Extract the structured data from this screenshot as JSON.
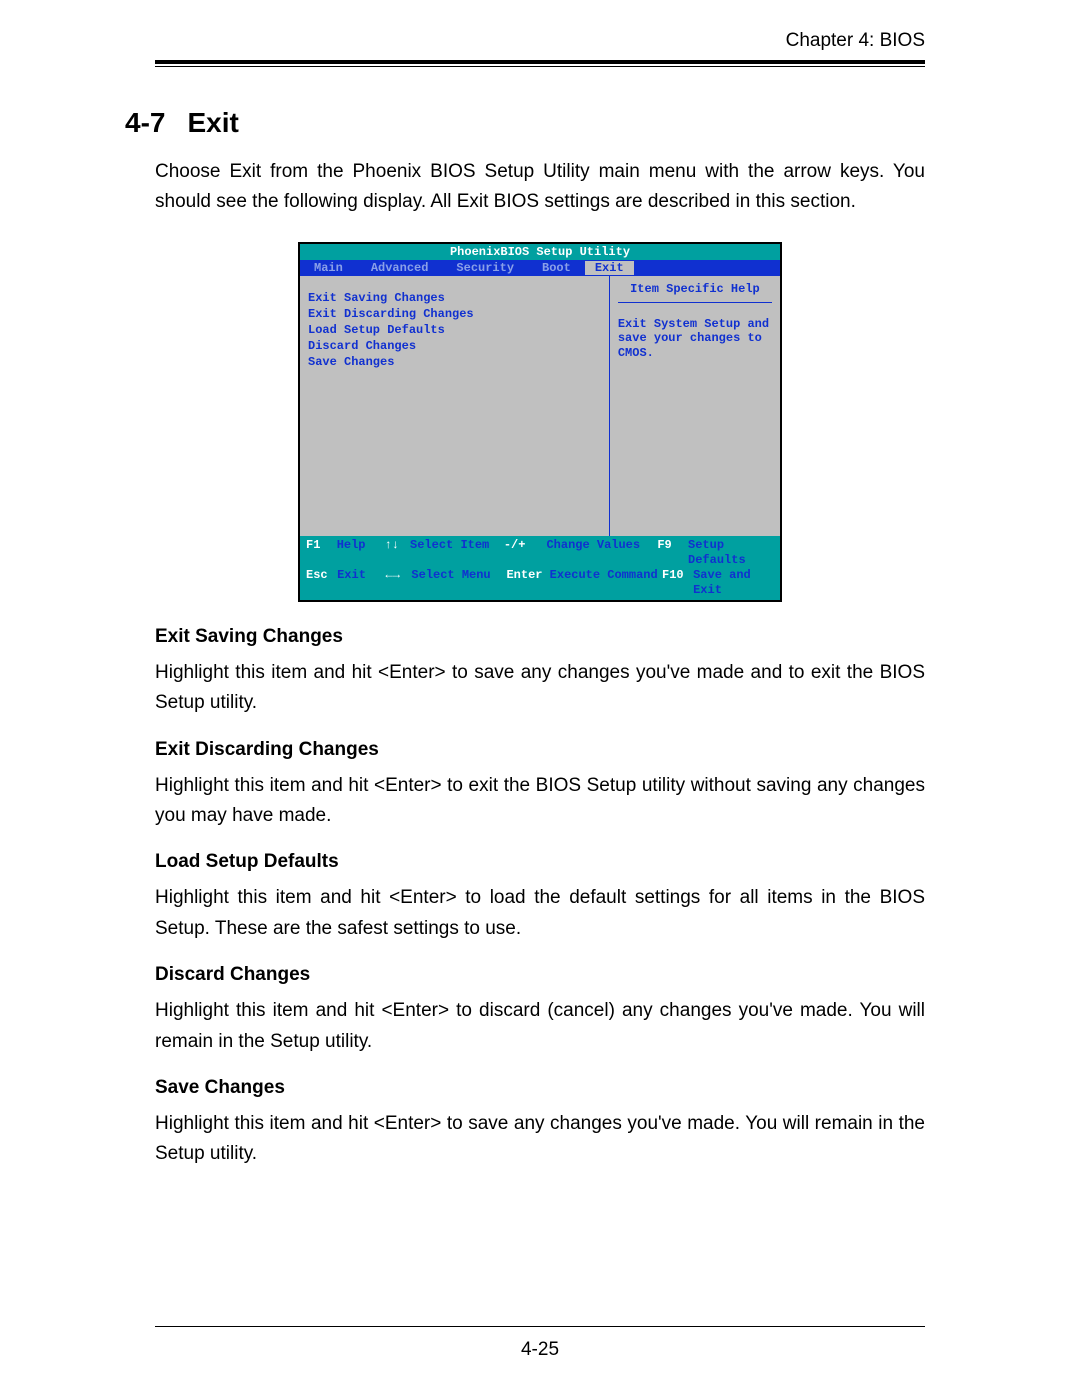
{
  "header": "Chapter 4: BIOS",
  "section": {
    "number": "4-7",
    "title": "Exit"
  },
  "intro": "Choose Exit from the Phoenix BIOS Setup Utility main menu with the arrow keys. You should see the following display. All Exit BIOS settings are described in this section.",
  "bios": {
    "title": "PhoenixBIOS Setup Utility",
    "menu": [
      "Main",
      "Advanced",
      "Security",
      "Boot",
      "Exit"
    ],
    "active_menu": "Exit",
    "items": [
      "Exit Saving Changes",
      "Exit Discarding Changes",
      "Load Setup Defaults",
      "Discard Changes",
      "Save Changes"
    ],
    "help_title": "Item Specific Help",
    "help_body": "Exit System Setup and save your changes to CMOS.",
    "footer": {
      "r1": {
        "k1": "F1",
        "l1": "Help",
        "k2": "↑↓",
        "l2": "Select Item",
        "k3": "-/+",
        "l3": "Change Values",
        "k4": "F9",
        "l4": "Setup Defaults"
      },
      "r2": {
        "k1": "Esc",
        "l1": "Exit",
        "k2": "←→",
        "l2": "Select Menu",
        "k3": "Enter",
        "l3": "Execute Command",
        "k4": "F10",
        "l4": "Save and Exit"
      }
    }
  },
  "subs": [
    {
      "title": "Exit Saving Changes",
      "body": "Highlight this item and hit <Enter> to save any changes you've made and to exit the BIOS Setup utility."
    },
    {
      "title": "Exit Discarding Changes",
      "body": "Highlight this item and hit <Enter> to exit the BIOS Setup utility without saving any changes you may have made."
    },
    {
      "title": "Load Setup Defaults",
      "body": "Highlight this item and hit <Enter> to load the default settings for all items in the BIOS Setup. These are the safest settings to use."
    },
    {
      "title": "Discard Changes",
      "body": "Highlight this item and hit <Enter> to discard (cancel) any changes you've made. You will remain in the Setup utility."
    },
    {
      "title": "Save Changes",
      "body": "Highlight this item and hit <Enter> to save any changes you've made. You will remain in the Setup utility."
    }
  ],
  "page_number": "4-25"
}
